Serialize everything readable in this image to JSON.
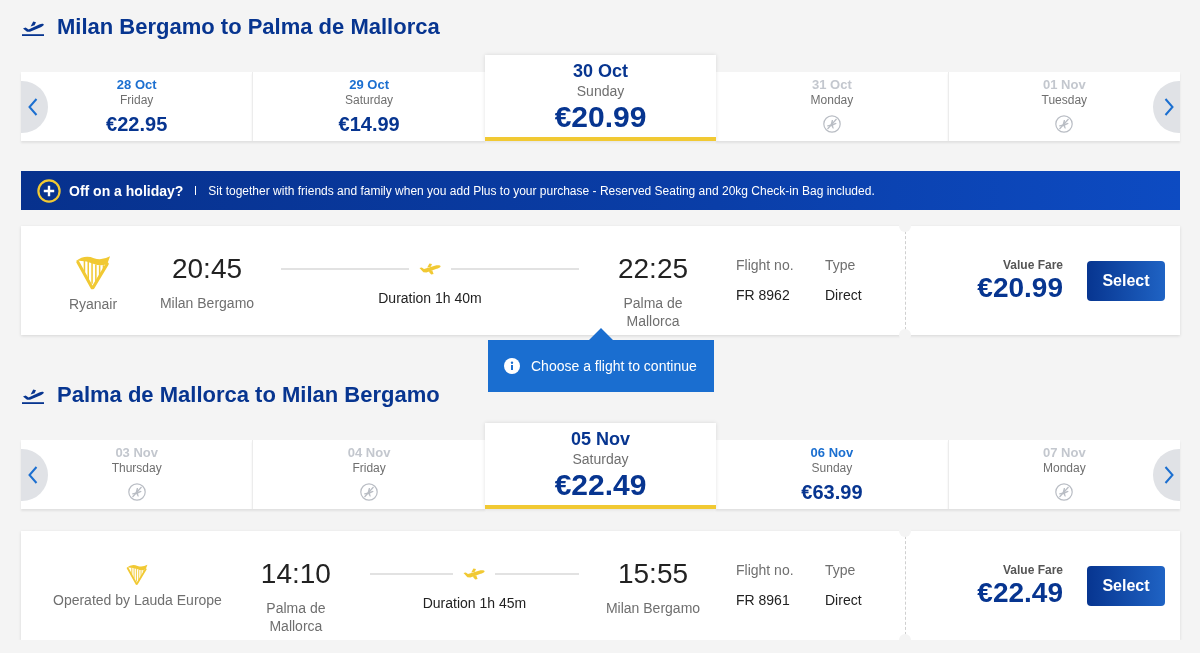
{
  "journeys": [
    {
      "title": "Milan Bergamo to Palma de Mallorca",
      "dates": [
        {
          "date": "28 Oct",
          "weekday": "Friday",
          "price": "€22.95",
          "available": true,
          "selected": false
        },
        {
          "date": "29 Oct",
          "weekday": "Saturday",
          "price": "€14.99",
          "available": true,
          "selected": false
        },
        {
          "date": "30 Oct",
          "weekday": "Sunday",
          "price": "€20.99",
          "available": true,
          "selected": true
        },
        {
          "date": "31 Oct",
          "weekday": "Monday",
          "available": false,
          "selected": false
        },
        {
          "date": "01 Nov",
          "weekday": "Tuesday",
          "available": false,
          "selected": false
        }
      ],
      "banner": {
        "title": "Off on a holiday?",
        "text": "Sit together with friends and family when you add Plus to your purchase - Reserved Seating and 20kg Check-in Bag included."
      },
      "flight": {
        "kind": "own",
        "airline": "Ryanair",
        "departure_time": "20:45",
        "departure_airport": "Milan Bergamo",
        "duration": "Duration 1h 40m",
        "arrival_time": "22:25",
        "arrival_airport": "Palma de Mallorca",
        "flight_no_label": "Flight no.",
        "flight_no": "FR 8962",
        "type_label": "Type",
        "type": "Direct",
        "fare_label": "Value Fare",
        "price": "€20.99",
        "button": "Select"
      },
      "tooltip": "Choose a flight to continue"
    },
    {
      "title": "Palma de Mallorca to Milan Bergamo",
      "dates": [
        {
          "date": "03 Nov",
          "weekday": "Thursday",
          "available": false,
          "selected": false
        },
        {
          "date": "04 Nov",
          "weekday": "Friday",
          "available": false,
          "selected": false
        },
        {
          "date": "05 Nov",
          "weekday": "Saturday",
          "price": "€22.49",
          "available": true,
          "selected": true
        },
        {
          "date": "06 Nov",
          "weekday": "Sunday",
          "price": "€63.99",
          "available": true,
          "selected": false
        },
        {
          "date": "07 Nov",
          "weekday": "Monday",
          "available": false,
          "selected": false
        }
      ],
      "flight": {
        "kind": "partner",
        "airline": "Operated by Lauda Europe",
        "departure_time": "14:10",
        "departure_airport": "Palma de Mallorca",
        "duration": "Duration 1h 45m",
        "arrival_time": "15:55",
        "arrival_airport": "Milan Bergamo",
        "flight_no_label": "Flight no.",
        "flight_no": "FR 8961",
        "type_label": "Type",
        "type": "Direct",
        "fare_label": "Value Fare",
        "price": "€22.49",
        "button": "Select"
      }
    }
  ]
}
